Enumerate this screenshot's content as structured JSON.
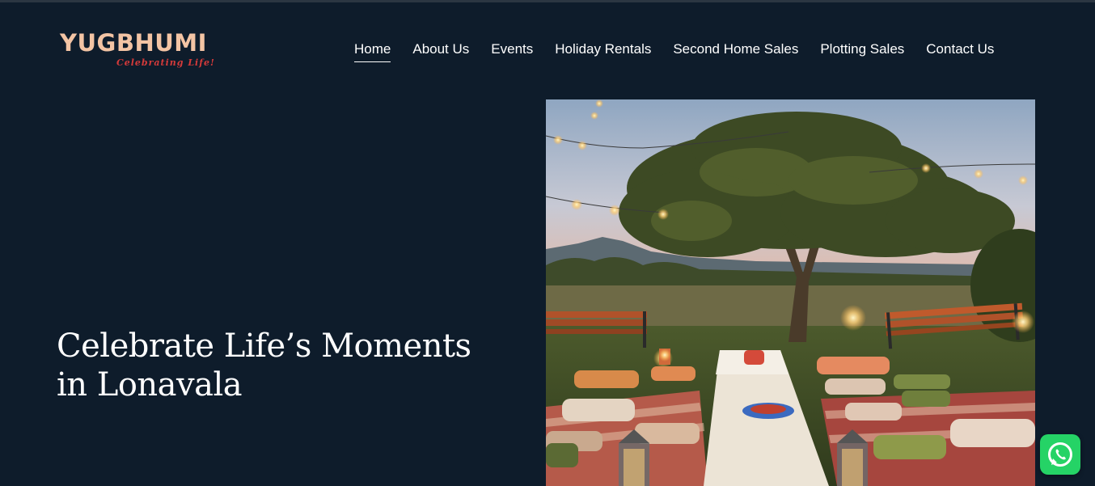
{
  "brand": {
    "name": "YUGBHUMI",
    "tagline": "Celebrating Life!"
  },
  "nav": {
    "items": [
      {
        "label": "Home",
        "active": true
      },
      {
        "label": "About Us",
        "active": false
      },
      {
        "label": "Events",
        "active": false
      },
      {
        "label": "Holiday Rentals",
        "active": false
      },
      {
        "label": "Second Home Sales",
        "active": false
      },
      {
        "label": "Plotting Sales",
        "active": false
      },
      {
        "label": "Contact Us",
        "active": false
      }
    ]
  },
  "hero": {
    "title_line1": "Celebrate Life’s Moments",
    "title_line2": "in Lonavala"
  },
  "icons": {
    "chat": "whatsapp-icon"
  },
  "colors": {
    "background": "#0e1c2b",
    "logo": "#f3c4a4",
    "tagline": "#d43a3a",
    "whatsapp": "#25d366"
  }
}
